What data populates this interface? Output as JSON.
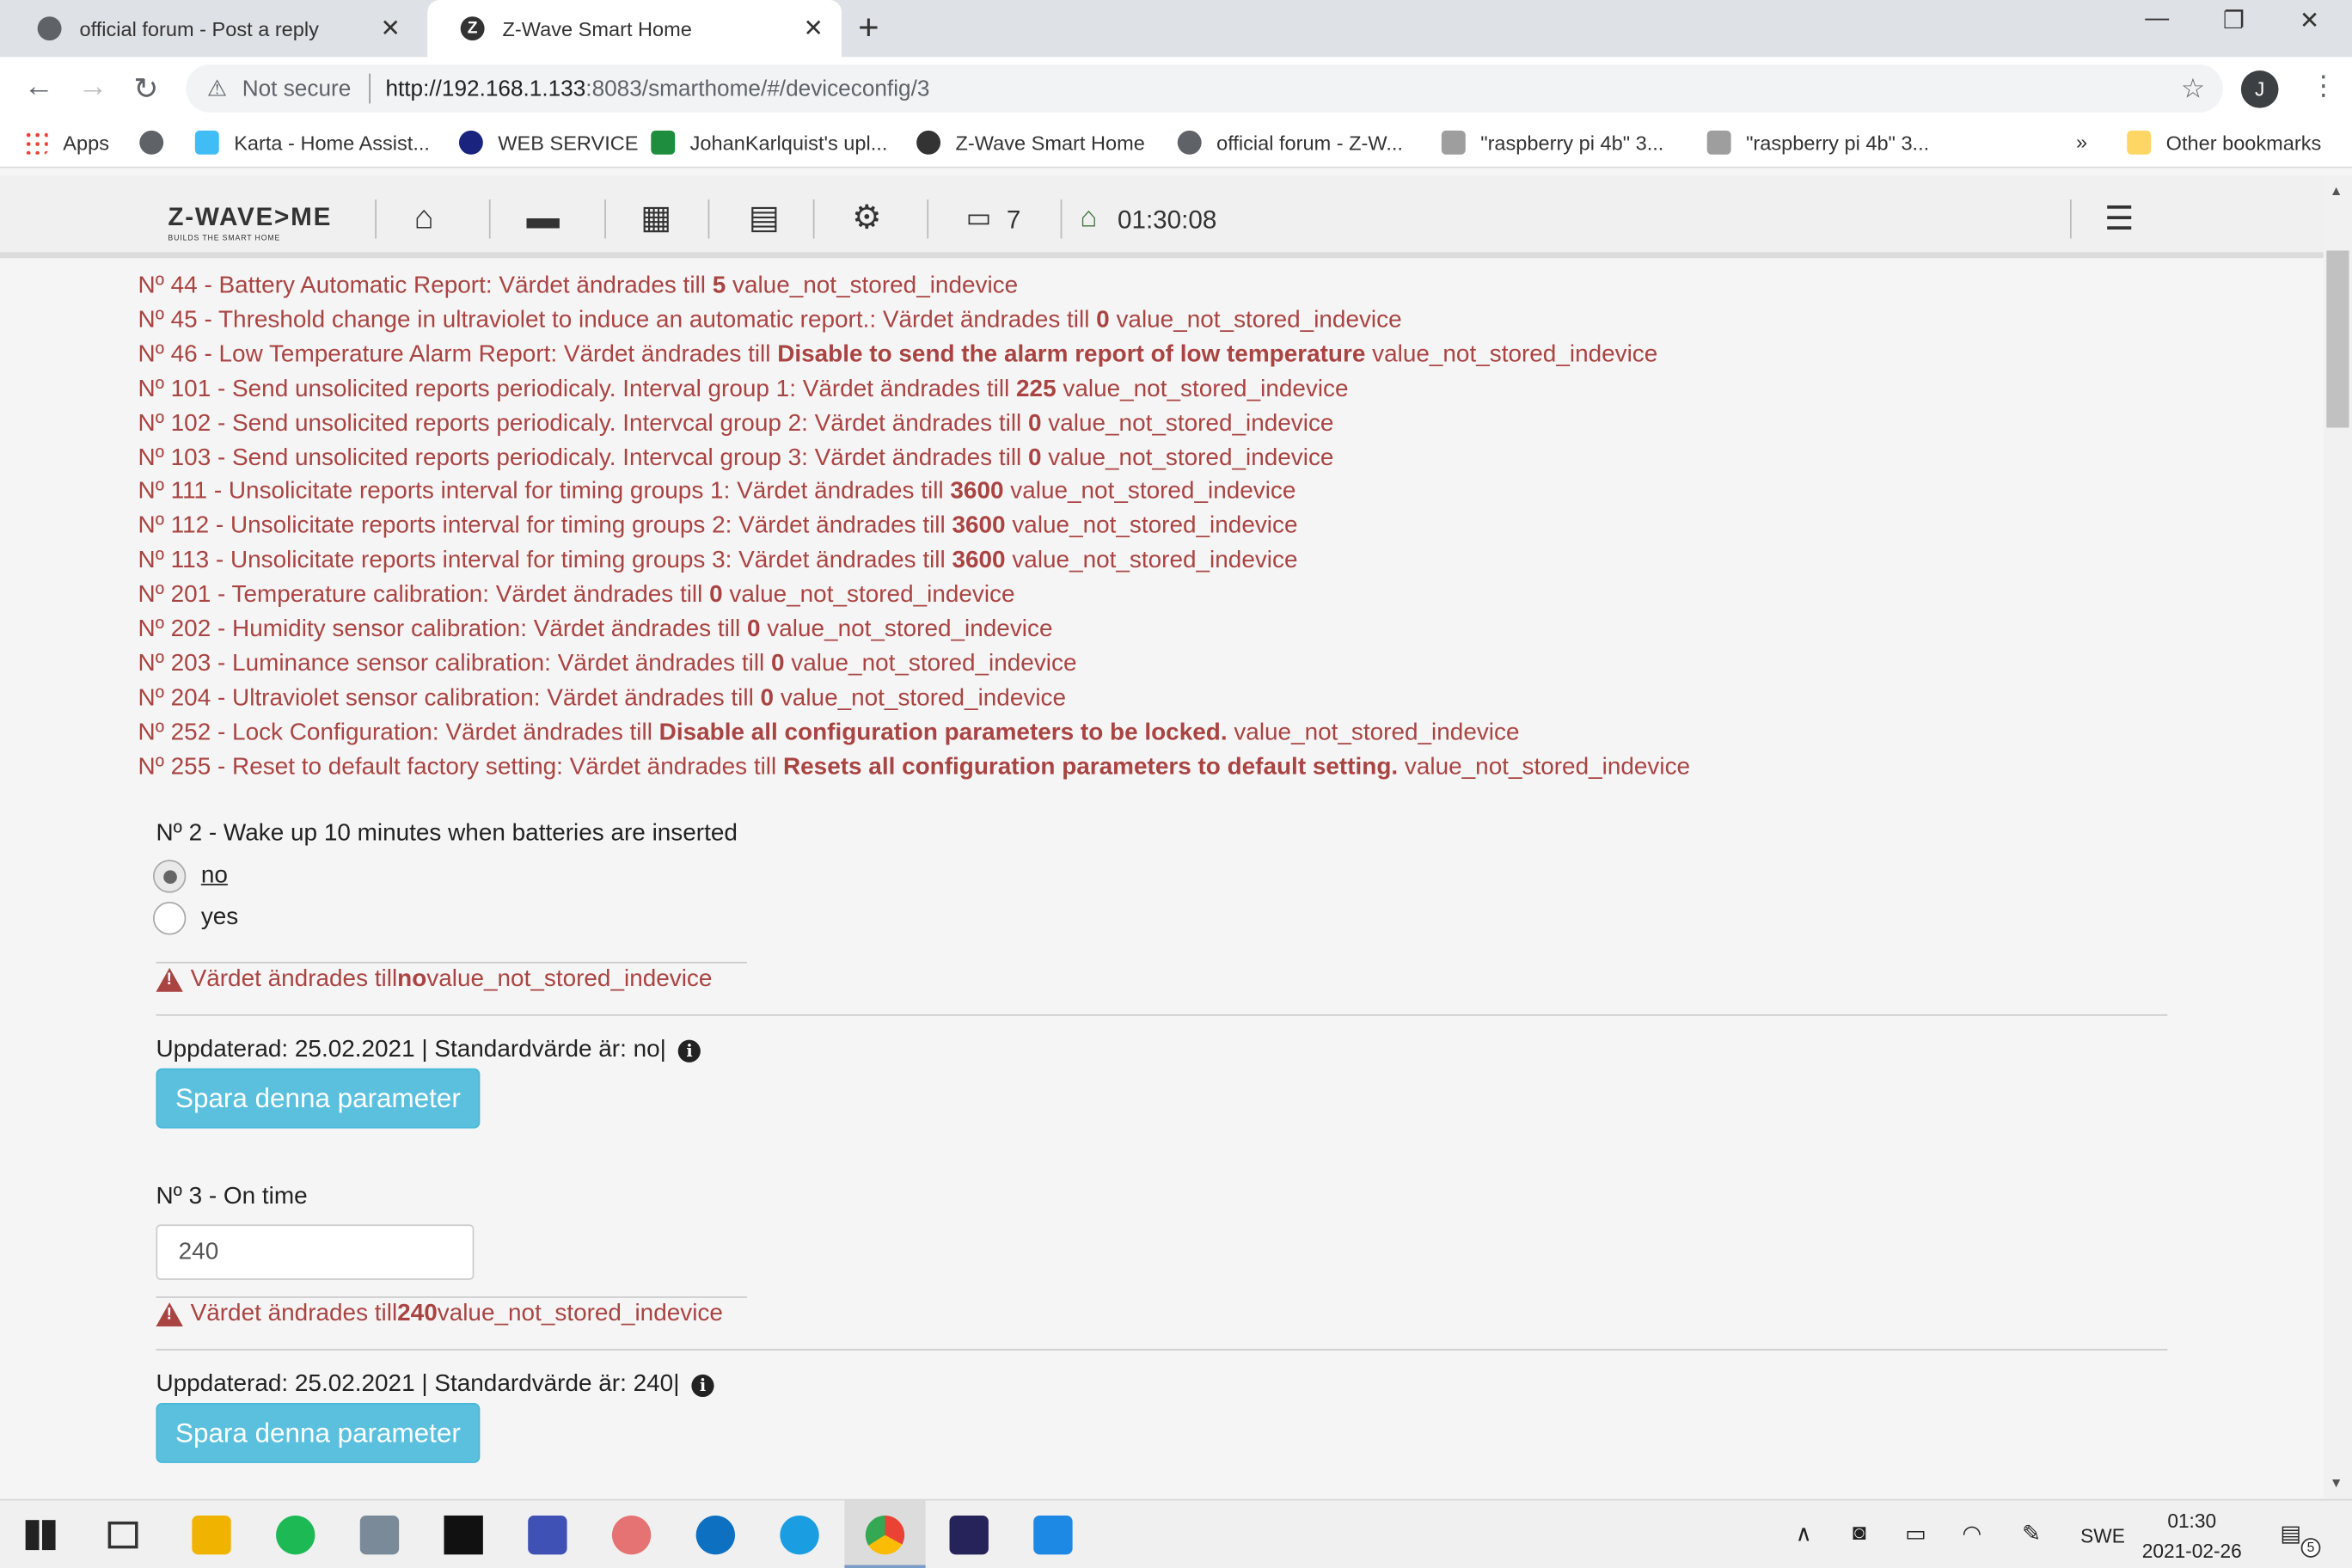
{
  "browser": {
    "tabs": [
      {
        "label": "official forum - Post a reply"
      },
      {
        "label": "Z-Wave Smart Home"
      }
    ],
    "omnibox": {
      "security": "Not secure",
      "url_host": "http://192.168.1.133",
      "url_rest": ":8083/smarthome/#/deviceconfig/3"
    },
    "profile_initial": "J",
    "bookmarks": [
      {
        "label": "Apps"
      },
      {
        "label": "Karta - Home Assist..."
      },
      {
        "label": "WEB SERVICE"
      },
      {
        "label": "JohanKarlquist's upl..."
      },
      {
        "label": "Z-Wave Smart Home"
      },
      {
        "label": "official forum - Z-W..."
      },
      {
        "label": "\"raspberry pi 4b\" 3..."
      },
      {
        "label": "\"raspberry pi 4b\" 3..."
      }
    ],
    "more_bookmarks": "»",
    "other_bookmarks": "Other bookmarks"
  },
  "appnav": {
    "brand": "Z-WAVE>ME",
    "brand_tag": "BUILDS THE SMART HOME",
    "events_count": "7",
    "time": "01:30:08"
  },
  "log": [
    {
      "prefix": "Nº 44 - Battery Automatic Report: Värdet ändrades till ",
      "value": "5",
      "suffix": " value_not_stored_indevice"
    },
    {
      "prefix": "Nº 45 - Threshold change in ultraviolet to induce an automatic report.: Värdet ändrades till ",
      "value": "0",
      "suffix": " value_not_stored_indevice"
    },
    {
      "prefix": "Nº 46 - Low Temperature Alarm Report: Värdet ändrades till ",
      "value": "Disable to send the alarm report of low temperature",
      "suffix": " value_not_stored_indevice"
    },
    {
      "prefix": "Nº 101 - Send unsolicited reports periodicaly. Interval group 1: Värdet ändrades till ",
      "value": "225",
      "suffix": " value_not_stored_indevice"
    },
    {
      "prefix": "Nº 102 - Send unsolicited reports periodicaly. Intervcal group 2: Värdet ändrades till ",
      "value": "0",
      "suffix": " value_not_stored_indevice"
    },
    {
      "prefix": "Nº 103 - Send unsolicited reports periodicaly. Intervcal group 3: Värdet ändrades till ",
      "value": "0",
      "suffix": " value_not_stored_indevice"
    },
    {
      "prefix": "Nº 111 - Unsolicitate reports interval for timing groups 1: Värdet ändrades till ",
      "value": "3600",
      "suffix": " value_not_stored_indevice"
    },
    {
      "prefix": "Nº 112 - Unsolicitate reports interval for timing groups 2: Värdet ändrades till ",
      "value": "3600",
      "suffix": " value_not_stored_indevice"
    },
    {
      "prefix": "Nº 113 - Unsolicitate reports interval for timing groups 3: Värdet ändrades till ",
      "value": "3600",
      "suffix": " value_not_stored_indevice"
    },
    {
      "prefix": "Nº 201 - Temperature calibration: Värdet ändrades till ",
      "value": "0",
      "suffix": " value_not_stored_indevice"
    },
    {
      "prefix": "Nº 202 - Humidity sensor calibration: Värdet ändrades till ",
      "value": "0",
      "suffix": " value_not_stored_indevice"
    },
    {
      "prefix": "Nº 203 - Luminance sensor calibration: Värdet ändrades till ",
      "value": "0",
      "suffix": " value_not_stored_indevice"
    },
    {
      "prefix": "Nº 204 - Ultraviolet sensor calibration: Värdet ändrades till ",
      "value": "0",
      "suffix": " value_not_stored_indevice"
    },
    {
      "prefix": "Nº 252 - Lock Configuration: Värdet ändrades till ",
      "value": "Disable all configuration parameters to be locked.",
      "suffix": " value_not_stored_indevice"
    },
    {
      "prefix": "Nº 255 - Reset to default factory setting: Värdet ändrades till ",
      "value": "Resets all configuration parameters to default setting.",
      "suffix": " value_not_stored_indevice"
    }
  ],
  "param2": {
    "title": "Nº 2 - Wake up 10 minutes when batteries are inserted",
    "options": [
      "no",
      "yes"
    ],
    "selected": "no",
    "alert_prefix": "Värdet ändrades till ",
    "alert_value": "no",
    "alert_suffix": " value_not_stored_indevice",
    "updated": "Uppdaterad: 25.02.2021 | Standardvärde är: no|",
    "save": "Spara denna parameter"
  },
  "param3": {
    "title": "Nº 3 - On time",
    "value": "240",
    "alert_prefix": "Värdet ändrades till ",
    "alert_value": "240",
    "alert_suffix": " value_not_stored_indevice",
    "updated": "Uppdaterad: 25.02.2021 | Standardvärde är: 240|",
    "save": "Spara denna parameter"
  },
  "taskbar": {
    "language": "SWE",
    "time": "01:30",
    "date": "2021-02-26",
    "notifications": "5"
  }
}
